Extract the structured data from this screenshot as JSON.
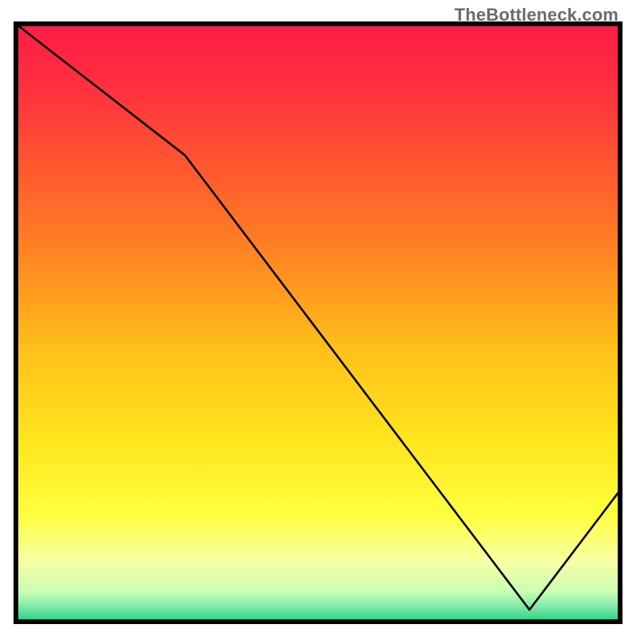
{
  "attribution": "TheBottleneck.com",
  "annotation_text": "",
  "chart_data": {
    "type": "line",
    "title": "",
    "xlabel": "",
    "ylabel": "",
    "xlim": [
      0,
      100
    ],
    "ylim": [
      0,
      100
    ],
    "grid": false,
    "legend": false,
    "note": "No axis ticks or labels are rendered; values are estimated proportions of the plot area.",
    "series": [
      {
        "name": "curve",
        "x": [
          0,
          28,
          85,
          100
        ],
        "y": [
          100,
          78,
          2,
          22
        ]
      }
    ],
    "minimum_point": {
      "x": 85,
      "y": 2
    },
    "background_gradient": {
      "type": "vertical",
      "stops": [
        {
          "offset": 0.0,
          "color": "#ff1c47"
        },
        {
          "offset": 0.1,
          "color": "#ff2f3f"
        },
        {
          "offset": 0.25,
          "color": "#ff5a2e"
        },
        {
          "offset": 0.4,
          "color": "#ff8a22"
        },
        {
          "offset": 0.55,
          "color": "#ffc21a"
        },
        {
          "offset": 0.7,
          "color": "#ffe61e"
        },
        {
          "offset": 0.82,
          "color": "#ffff3e"
        },
        {
          "offset": 0.9,
          "color": "#f6ffa6"
        },
        {
          "offset": 0.95,
          "color": "#c8ffb3"
        },
        {
          "offset": 0.975,
          "color": "#7fe9a9"
        },
        {
          "offset": 1.0,
          "color": "#1fd083"
        }
      ]
    }
  },
  "plot_geometry": {
    "outer_size": 800,
    "inner_left": 20,
    "inner_top": 30,
    "inner_width": 760,
    "inner_height": 752,
    "frame_stroke": "#000000",
    "frame_stroke_width": 6,
    "line_stroke": "#000000",
    "line_stroke_width": 2.6
  }
}
